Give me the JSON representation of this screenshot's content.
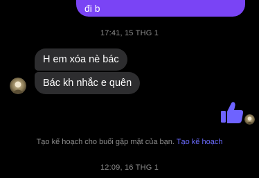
{
  "messages": {
    "outgoing_prev": "đi b",
    "timestamp_1": "17:41, 15 THG 1",
    "incoming_1": "H em xóa nè bác",
    "incoming_2": "Bác kh nhắc e quên",
    "timestamp_2": "12:09, 16 THG 1"
  },
  "plan_prompt": {
    "text": "Tạo kế hoạch cho buổi gặp mặt của bạn.",
    "link": "Tạo kế hoạch"
  },
  "colors": {
    "outgoing_bubble": "#7a44f5",
    "incoming_bubble": "#2d2d2f",
    "like": "#6e63ff",
    "link": "#6b6bff"
  },
  "icons": {
    "like": "thumbs-up-icon"
  }
}
